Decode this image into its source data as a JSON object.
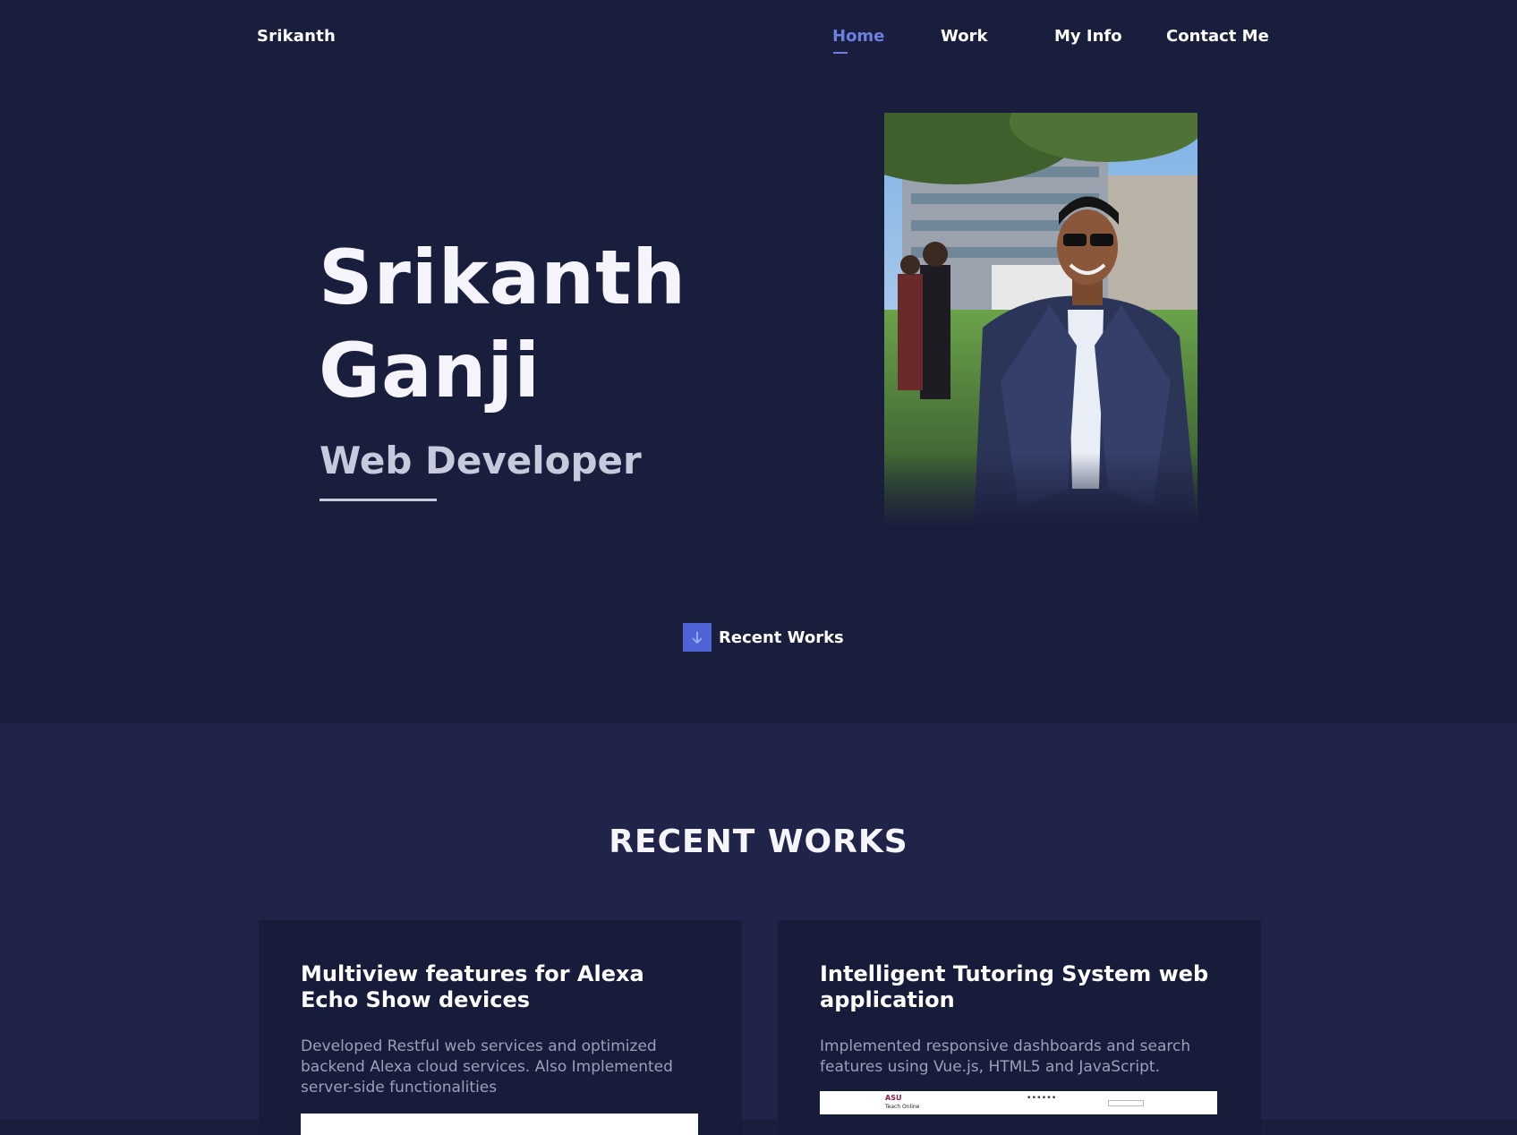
{
  "nav": {
    "brand": "Srikanth",
    "links": [
      "Home",
      "Work",
      "My Info",
      "Contact Me"
    ],
    "active": "Home",
    "accent_color": "#6d7fe0"
  },
  "hero": {
    "first_name": "Srikanth",
    "last_name": "Ganji",
    "role": "Web Developer",
    "photo_icon": "portrait-photo",
    "scroll_label": "Recent Works",
    "scroll_icon": "arrow-down-icon",
    "scroll_accent": "#4d63d6"
  },
  "works": {
    "title": "RECENT WORKS",
    "cards": [
      {
        "title": "Multiview features for Alexa Echo Show devices",
        "description": "Developed Restful web services and optimized backend Alexa cloud services. Also Implemented server-side functionalities"
      },
      {
        "title": "Intelligent Tutoring System web application",
        "description": "Implemented responsive dashboards and search features using Vue.js, HTML5 and JavaScript.",
        "screenshot": {
          "logo": "ASU",
          "subtitle": "Teach Online"
        }
      }
    ]
  },
  "colors": {
    "hero_bg": "#1a1e3d",
    "works_bg": "#1f2448",
    "card_bg": "#181c3b"
  }
}
